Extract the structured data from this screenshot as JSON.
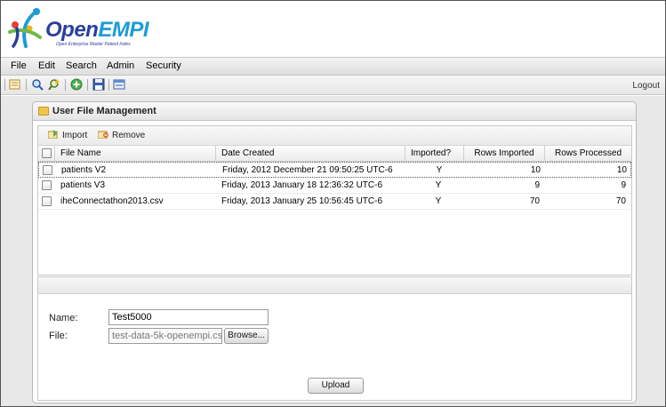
{
  "app": {
    "logo_name_prefix": "Open",
    "logo_name_suffix": "EMPI",
    "logo_tagline": "Open Enterprise Master Patient Index"
  },
  "menu": [
    "File",
    "Edit",
    "Search",
    "Admin",
    "Security"
  ],
  "toolbar": {
    "icons": [
      "edit-icon",
      "search-icon",
      "advanced-search-icon",
      "add-icon",
      "save-icon",
      "report-icon"
    ],
    "logout_label": "Logout"
  },
  "panel": {
    "title": "User File Management",
    "actions": {
      "import_label": "Import",
      "remove_label": "Remove"
    },
    "columns": [
      "File Name",
      "Date Created",
      "Imported?",
      "Rows Imported",
      "Rows Processed"
    ],
    "rows": [
      {
        "file_name": "patients V2",
        "date_created": "Friday, 2012 December 21 09:50:25 UTC-6",
        "imported": "Y",
        "rows_imported": "10",
        "rows_processed": "10"
      },
      {
        "file_name": "patients V3",
        "date_created": "Friday, 2013 January 18 12:36:32 UTC-6",
        "imported": "Y",
        "rows_imported": "9",
        "rows_processed": "9"
      },
      {
        "file_name": "iheConnectathon2013.csv",
        "date_created": "Friday, 2013 January 25 10:56:45 UTC-6",
        "imported": "Y",
        "rows_imported": "70",
        "rows_processed": "70"
      }
    ]
  },
  "form": {
    "name_label": "Name:",
    "name_value": "Test5000",
    "file_label": "File:",
    "file_value": "test-data-5k-openempi.cs",
    "browse_label": "Browse...",
    "upload_label": "Upload"
  },
  "colors": {
    "brand_dark": "#2a3f9a",
    "brand_light": "#1d9bd7",
    "import_icon": "#6aa84f",
    "remove_icon": "#e06d3a"
  }
}
